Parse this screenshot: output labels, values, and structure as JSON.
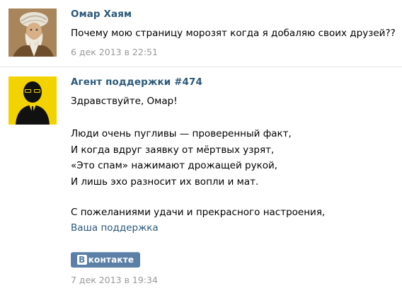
{
  "messages": [
    {
      "author": "Омар Хаям",
      "text": "Почему мою страницу морозят когда я добаляю своих друзей??",
      "date": "6 дек 2013 в 22:51",
      "avatar_icon": "bearded-man-portrait-avatar"
    },
    {
      "author": "Агент поддержки #474",
      "greeting": "Здравствуйте, Омар!",
      "poem": [
        "Люди очень пугливы — проверенный факт,",
        "И когда вдруг заявку от мёртвых узрят,",
        "«Это спам» нажимают дрожащей рукой,",
        "И лишь эхо разносит их вопли и мат."
      ],
      "closing": "С пожеланиями удачи и прекрасного настроения,",
      "signature": "Ваша поддержка",
      "logo": {
        "b": "В",
        "word": "контакте"
      },
      "date": "7 дек 2013 в 19:34",
      "avatar_icon": "agent-sunglasses-avatar"
    }
  ],
  "colors": {
    "link": "#2b587a",
    "date": "#999999",
    "logo_bg": "#5b7fa6",
    "divider": "#dfe3e8"
  }
}
